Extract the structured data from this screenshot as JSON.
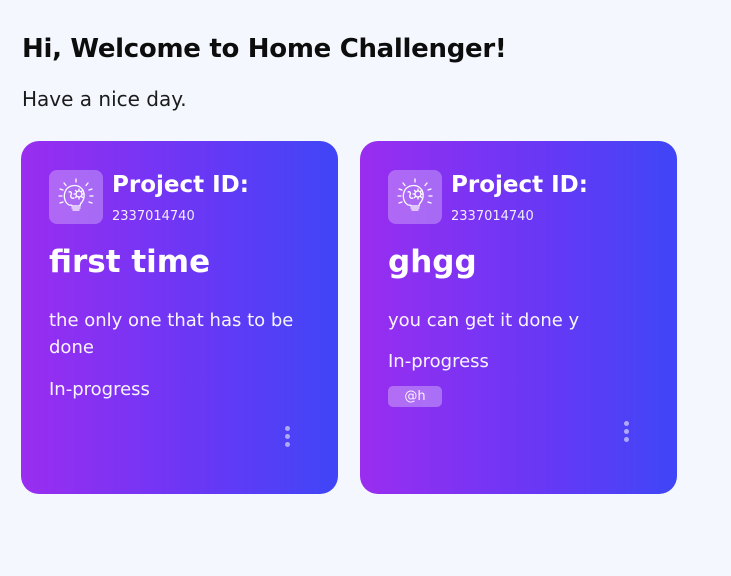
{
  "header": {
    "greeting": "Hi, Welcome to Home Challenger!",
    "subtitle": "Have a nice day."
  },
  "colors": {
    "background": "#f4f7fd",
    "card_gradient_start": "#9a2df0",
    "card_gradient_end": "#3f46f7",
    "card_text": "#ffffff"
  },
  "projects": [
    {
      "icon": "brain-lightbulb-gear-icon",
      "label": "Project ID:",
      "id": "2337014740",
      "title": "first time",
      "description": "the only one that has to be done",
      "status": "In-progress",
      "tag": "",
      "menu_icon": "vertical-dots-icon"
    },
    {
      "icon": "brain-lightbulb-gear-icon",
      "label": "Project ID:",
      "id": "2337014740",
      "title": "ghgg",
      "description": "you can get it done y",
      "status": "In-progress",
      "tag": "@h",
      "menu_icon": "vertical-dots-icon"
    }
  ]
}
